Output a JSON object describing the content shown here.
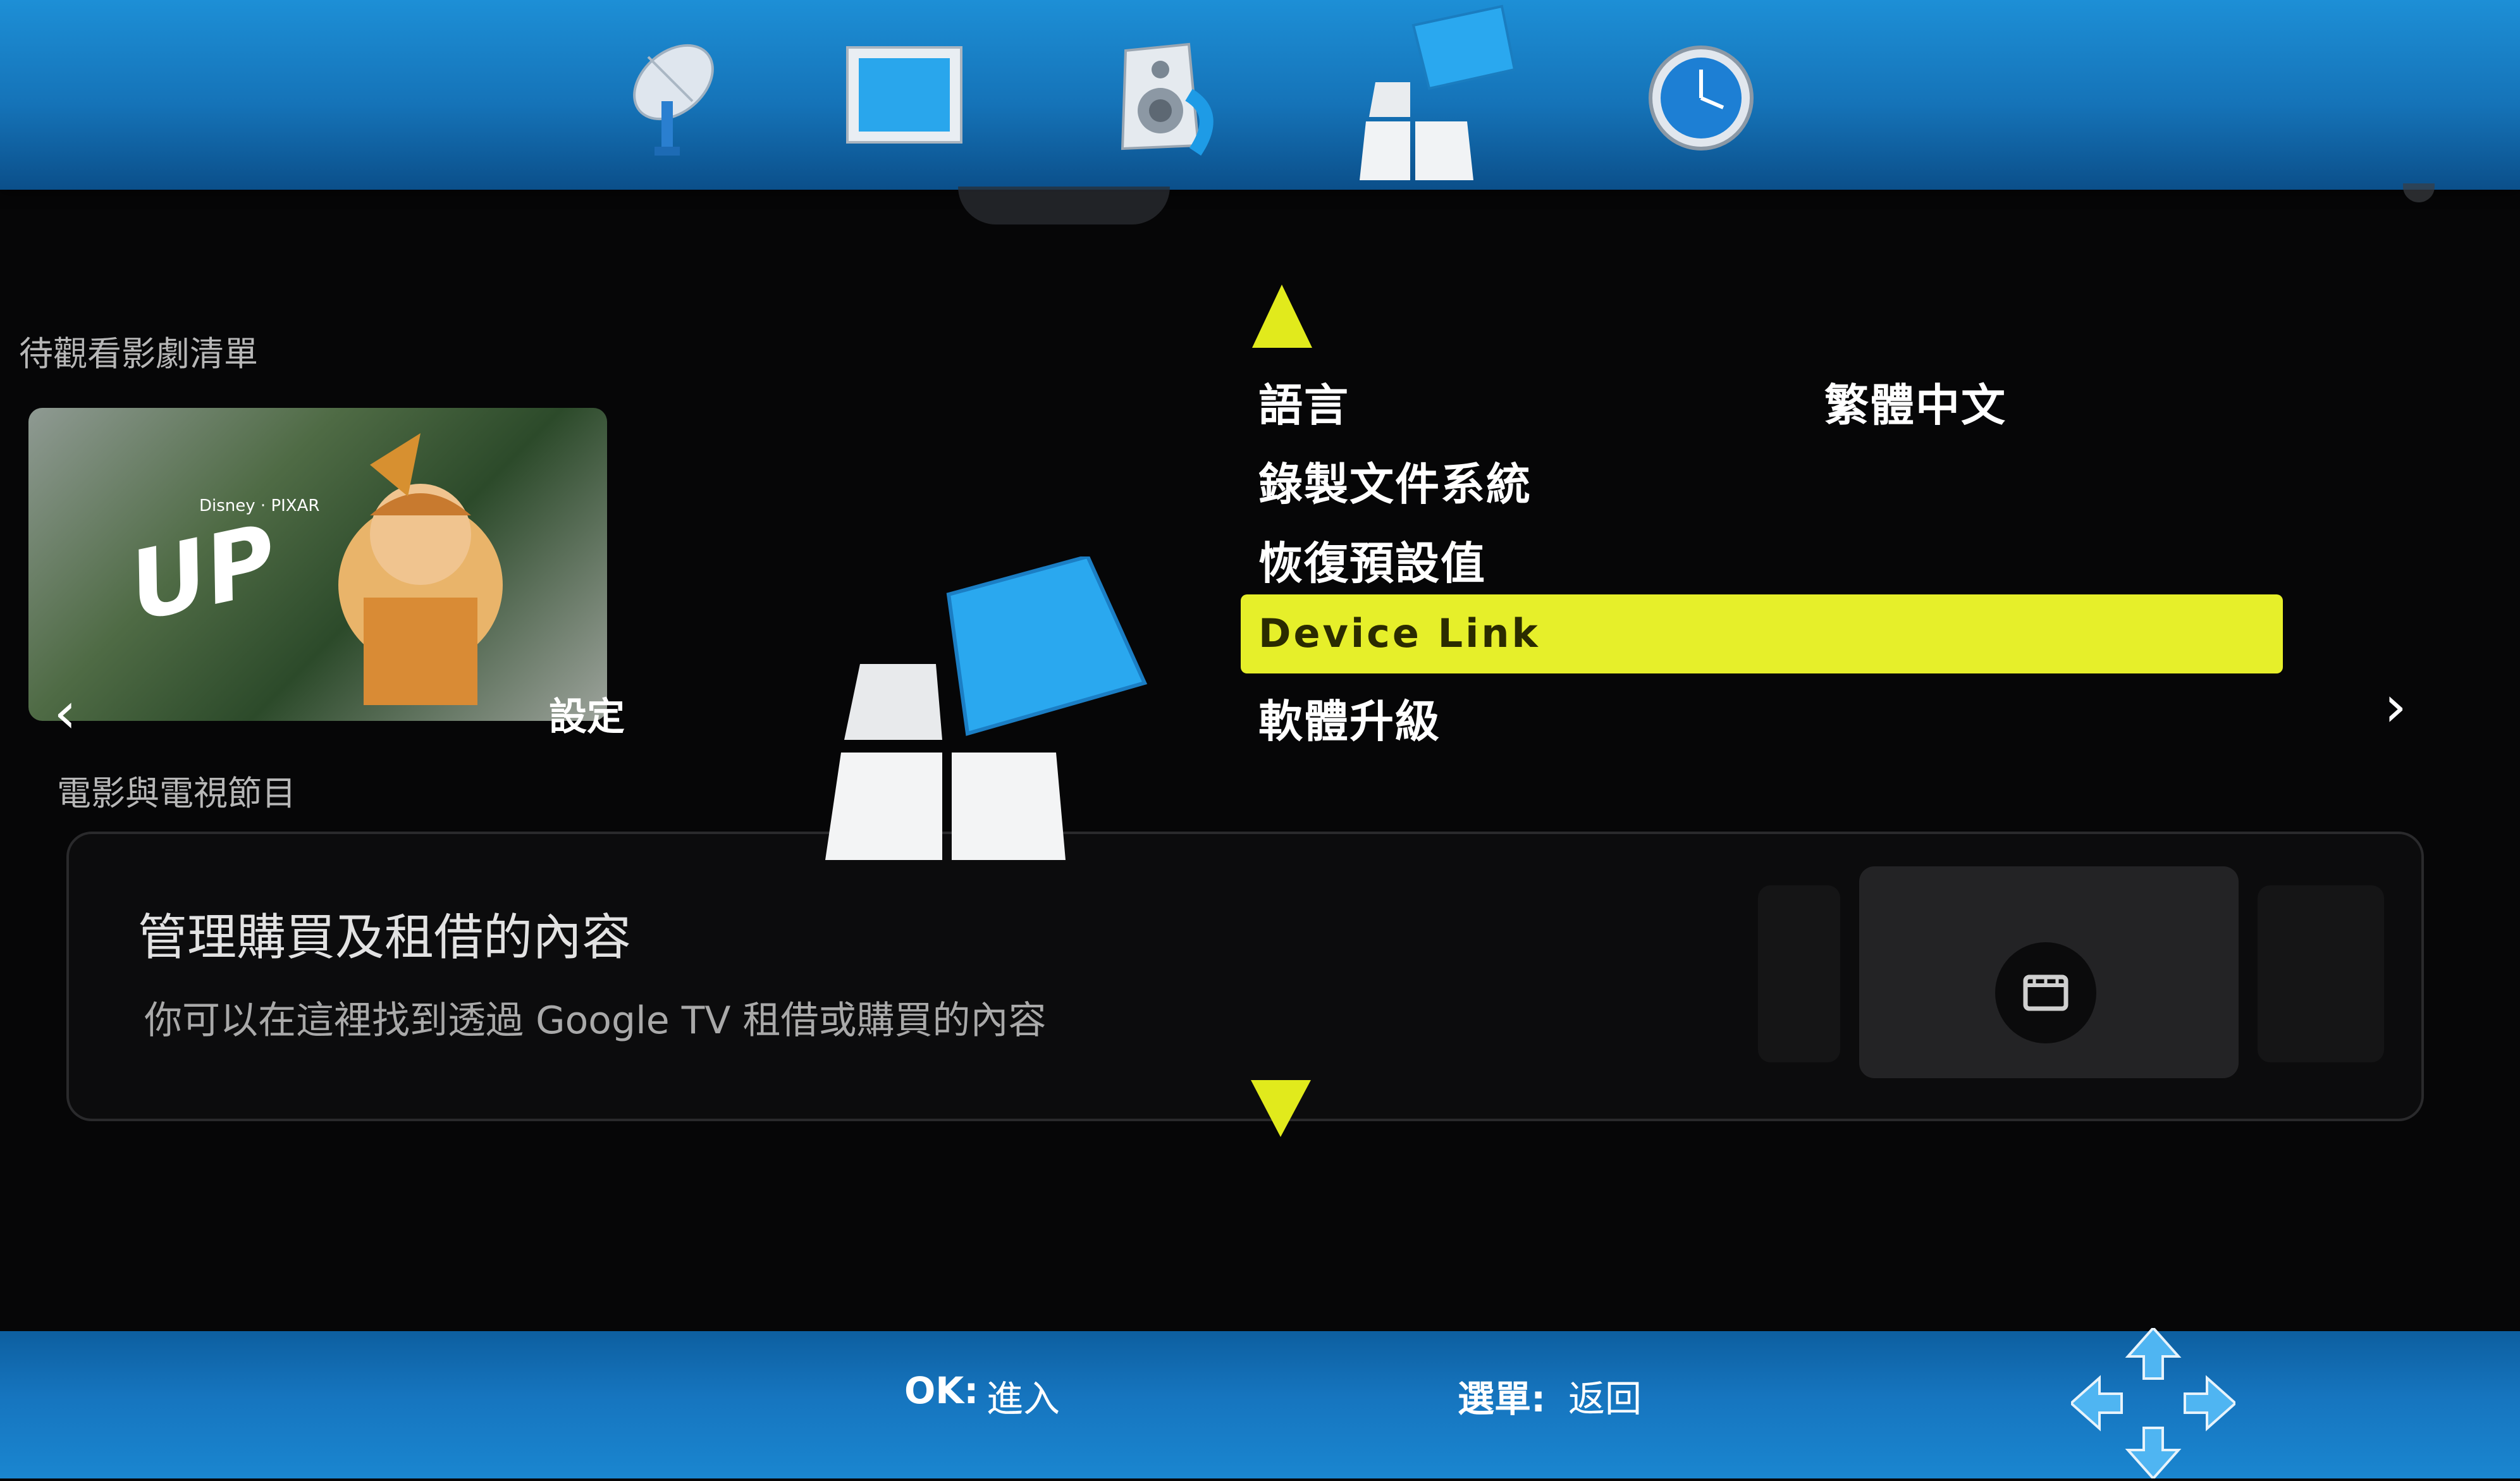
{
  "top_bar": {
    "icons": [
      "satellite-dish-icon",
      "display-screen-icon",
      "speaker-icon",
      "settings-blocks-icon",
      "clock-icon"
    ],
    "selected_index": 3
  },
  "background_gtv": {
    "watchlist_label": "待觀看影劇清單",
    "poster_title": "UP",
    "poster_brand": "Disney · PIXAR",
    "settings_label": "設定",
    "movies_tv_label": "電影與電視節目",
    "card_title": "管理購買及租借的內容",
    "card_subtitle": "你可以在這裡找到透過 Google TV 租借或購買的內容"
  },
  "menu": {
    "items": [
      {
        "label": "語言",
        "value": "繁體中文"
      },
      {
        "label": "錄製文件系統"
      },
      {
        "label": "恢復預設值"
      },
      {
        "label": "Device  Link",
        "selected": true
      },
      {
        "label": "軟體升級"
      }
    ]
  },
  "bottom_bar": {
    "ok_key": "OK:",
    "ok_action": "進入",
    "menu_key": "選單:",
    "menu_action": "返回"
  },
  "colors": {
    "top_bar": "#1a85cc",
    "highlight": "#e6ef2a",
    "arrow": "#e1ea1c",
    "background": "#060607"
  }
}
